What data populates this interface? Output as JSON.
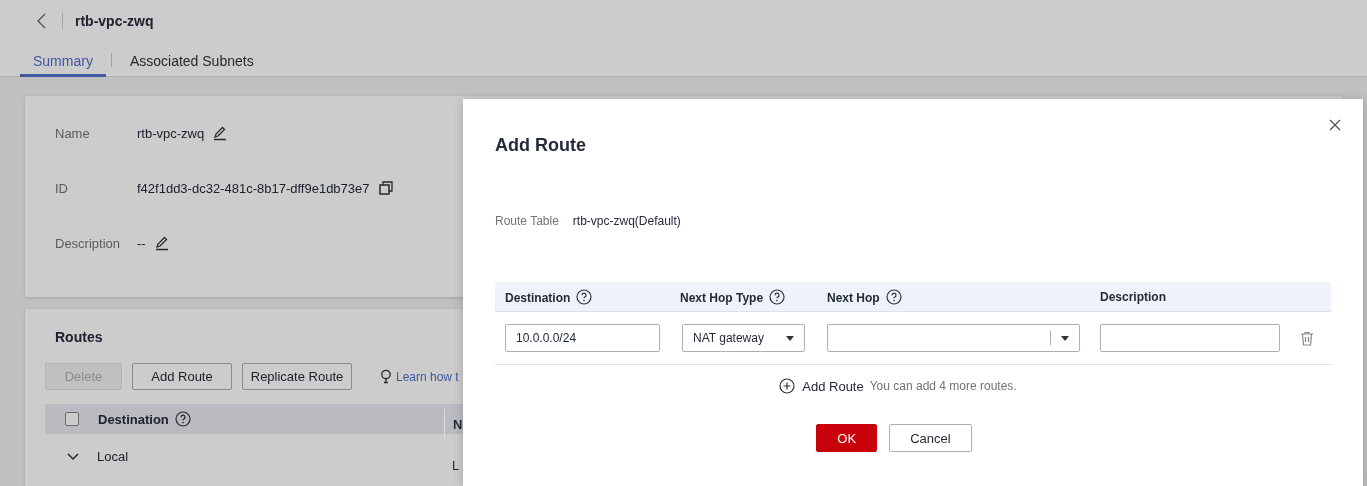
{
  "header": {
    "title": "rtb-vpc-zwq"
  },
  "tabs": [
    {
      "label": "Summary",
      "selected": true
    },
    {
      "label": "Associated Subnets",
      "selected": false
    }
  ],
  "summary": {
    "fields": [
      {
        "label": "Name",
        "value": "rtb-vpc-zwq",
        "kind": "edit"
      },
      {
        "label": "ID",
        "value": "f42f1dd3-dc32-481c-8b17-dff9e1db73e7",
        "kind": "copy"
      },
      {
        "label": "Description",
        "value": "--",
        "kind": "edit"
      }
    ]
  },
  "routes": {
    "title": "Routes",
    "buttons": [
      {
        "label": "Delete",
        "disabled": true
      },
      {
        "label": "Add Route",
        "disabled": false
      },
      {
        "label": "Replicate Route",
        "disabled": false
      }
    ],
    "learn_link": "Learn how t",
    "table": {
      "select_all_checked": false,
      "columns": [
        {
          "label": "Destination",
          "help": true
        },
        {
          "label": "N",
          "help": false
        }
      ],
      "rows": [
        {
          "expanded": false,
          "cells": [
            "Local",
            "L"
          ]
        }
      ]
    }
  },
  "dialog": {
    "title": "Add Route",
    "route_table": {
      "label": "Route Table",
      "value": "rtb-vpc-zwq(Default)"
    },
    "columns": [
      {
        "label": "Destination",
        "help": true
      },
      {
        "label": "Next Hop Type",
        "help": true
      },
      {
        "label": "Next Hop",
        "help": true
      },
      {
        "label": "Description",
        "help": false
      }
    ],
    "rows": [
      {
        "destination": "10.0.0.0/24",
        "next_hop_type": "NAT gateway"
      }
    ],
    "add_route": {
      "label": "Add Route",
      "hint": "You can add 4 more routes."
    },
    "buttons": [
      {
        "label": "OK",
        "kind": "primary"
      },
      {
        "label": "Cancel",
        "kind": "default"
      }
    ]
  }
}
